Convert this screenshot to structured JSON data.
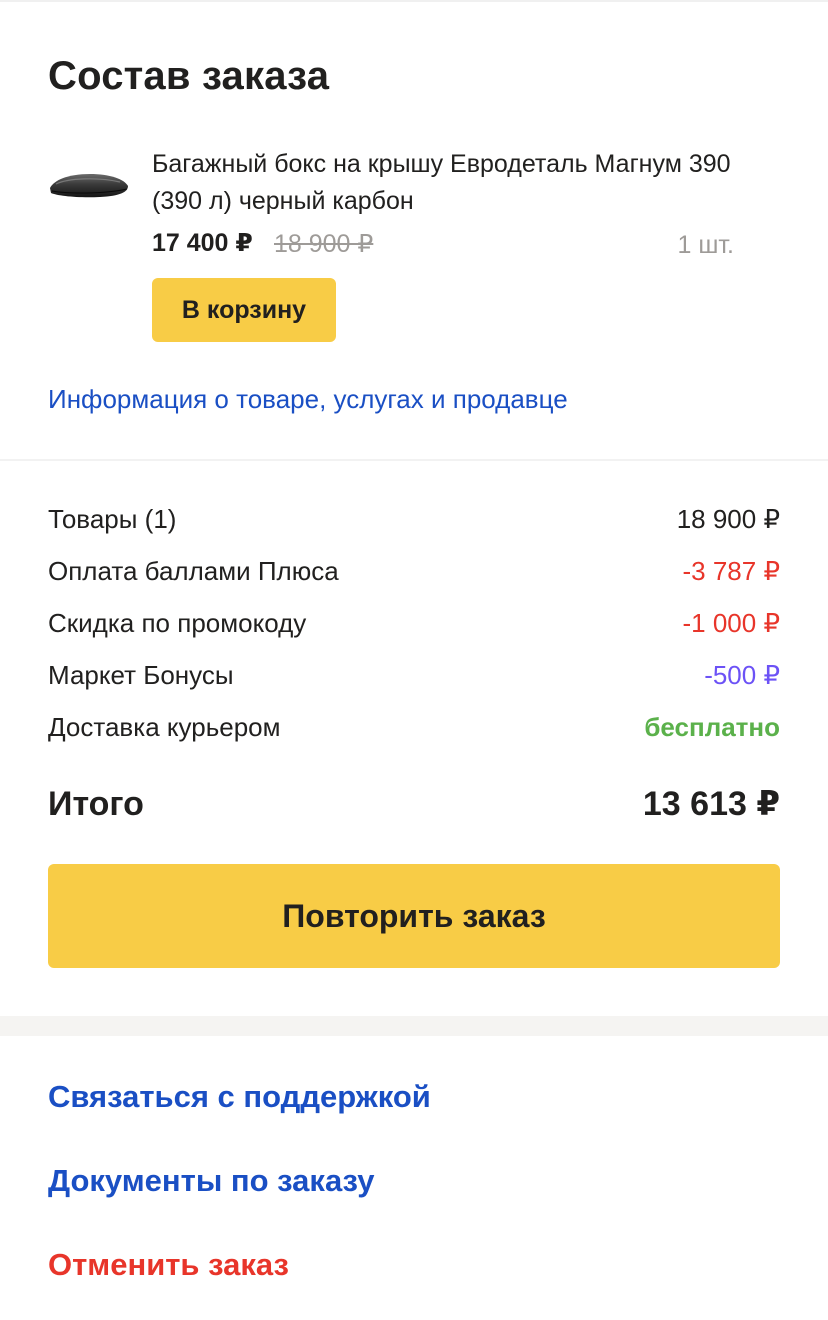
{
  "order": {
    "title": "Состав заказа",
    "product": {
      "image_icon": "roof-box-image",
      "name": "Багажный бокс на крышу Евродеталь Магнум 390 (390 л) черный карбон",
      "price": "17 400 ₽",
      "old_price": "18 900 ₽",
      "quantity": "1 шт.",
      "cart_button": "В корзину"
    },
    "info_link": "Информация о товаре, услугах и продавце"
  },
  "summary": {
    "rows": [
      {
        "label": "Товары (1)",
        "value": "18 900 ₽",
        "color": "#21201f"
      },
      {
        "label": "Оплата баллами Плюса",
        "value": "-3 787 ₽",
        "color": "#e8352a"
      },
      {
        "label": "Скидка по промокоду",
        "value": "-1 000 ₽",
        "color": "#e8352a"
      },
      {
        "label": "Маркет Бонусы",
        "value": "-500 ₽",
        "color": "#6c52f6"
      },
      {
        "label": "Доставка курьером",
        "value": "бесплатно",
        "color": "#5bb14b"
      }
    ],
    "total_label": "Итого",
    "total_value": "13 613 ₽",
    "repeat_button": "Повторить заказ"
  },
  "actions": {
    "support": "Связаться с поддержкой",
    "documents": "Документы по заказу",
    "cancel": "Отменить заказ"
  },
  "colors": {
    "accent_yellow": "#f8cc46",
    "link_blue": "#1a4fc4",
    "danger_red": "#e8352a",
    "bonus_purple": "#6c52f6",
    "success_green": "#5bb14b"
  }
}
